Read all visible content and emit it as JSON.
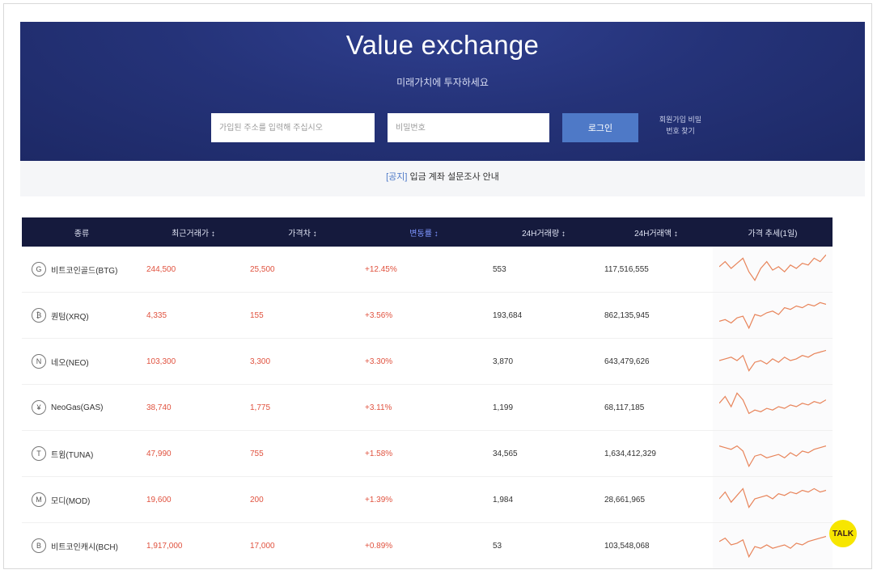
{
  "hero": {
    "title": "Value exchange",
    "subtitle": "미래가치에 투자하세요",
    "id_placeholder": "가입된 주소를 입력해 주십시오",
    "pw_placeholder": "비밀번호",
    "login_label": "로그인",
    "find_link": "회원가입 비밀번호 찾기"
  },
  "notice": {
    "tag": "[공지]",
    "text": " 입금 계좌 설문조사 안내"
  },
  "table": {
    "headers": [
      "종류",
      "최근거래가 ↕",
      "가격차 ↕",
      "변동률 ↕",
      "24H거래량 ↕",
      "24H거래액 ↕",
      "가격 추세(1일)"
    ],
    "rows": [
      {
        "icon": "bitcoin-gold-icon",
        "glyph": "G",
        "name": "비트코인골드(BTG)",
        "price": "244,500",
        "diff": "25,500",
        "rate": "+12.45%",
        "volume": "553",
        "amount": "117,516,555"
      },
      {
        "icon": "bitcoin-icon",
        "glyph": "₿",
        "name": "퀀텀(XRQ)",
        "price": "4,335",
        "diff": "155",
        "rate": "+3.56%",
        "volume": "193,684",
        "amount": "862,135,945"
      },
      {
        "icon": "neo-icon",
        "glyph": "N",
        "name": "네오(NEO)",
        "price": "103,300",
        "diff": "3,300",
        "rate": "+3.30%",
        "volume": "3,870",
        "amount": "643,479,626"
      },
      {
        "icon": "neogas-icon",
        "glyph": "¥",
        "name": "NeoGas(GAS)",
        "price": "38,740",
        "diff": "1,775",
        "rate": "+3.11%",
        "volume": "1,199",
        "amount": "68,117,185"
      },
      {
        "icon": "tuna-icon",
        "glyph": "T",
        "name": "트윔(TUNA)",
        "price": "47,990",
        "diff": "755",
        "rate": "+1.58%",
        "volume": "34,565",
        "amount": "1,634,412,329"
      },
      {
        "icon": "modi-icon",
        "glyph": "M",
        "name": "모디(MOD)",
        "price": "19,600",
        "diff": "200",
        "rate": "+1.39%",
        "volume": "1,984",
        "amount": "28,661,965"
      },
      {
        "icon": "bitcoin-cash-icon",
        "glyph": "B",
        "name": "비트코인캐시(BCH)",
        "price": "1,917,000",
        "diff": "17,000",
        "rate": "+0.89%",
        "volume": "53",
        "amount": "103,548,068"
      }
    ]
  },
  "talk_label": "TALK",
  "colors": {
    "header_bg": "#253379",
    "table_head_bg": "#151a3d",
    "rise_red": "#e0523f",
    "login_blue": "#4e79c7",
    "spark_line": "#e8845a"
  }
}
